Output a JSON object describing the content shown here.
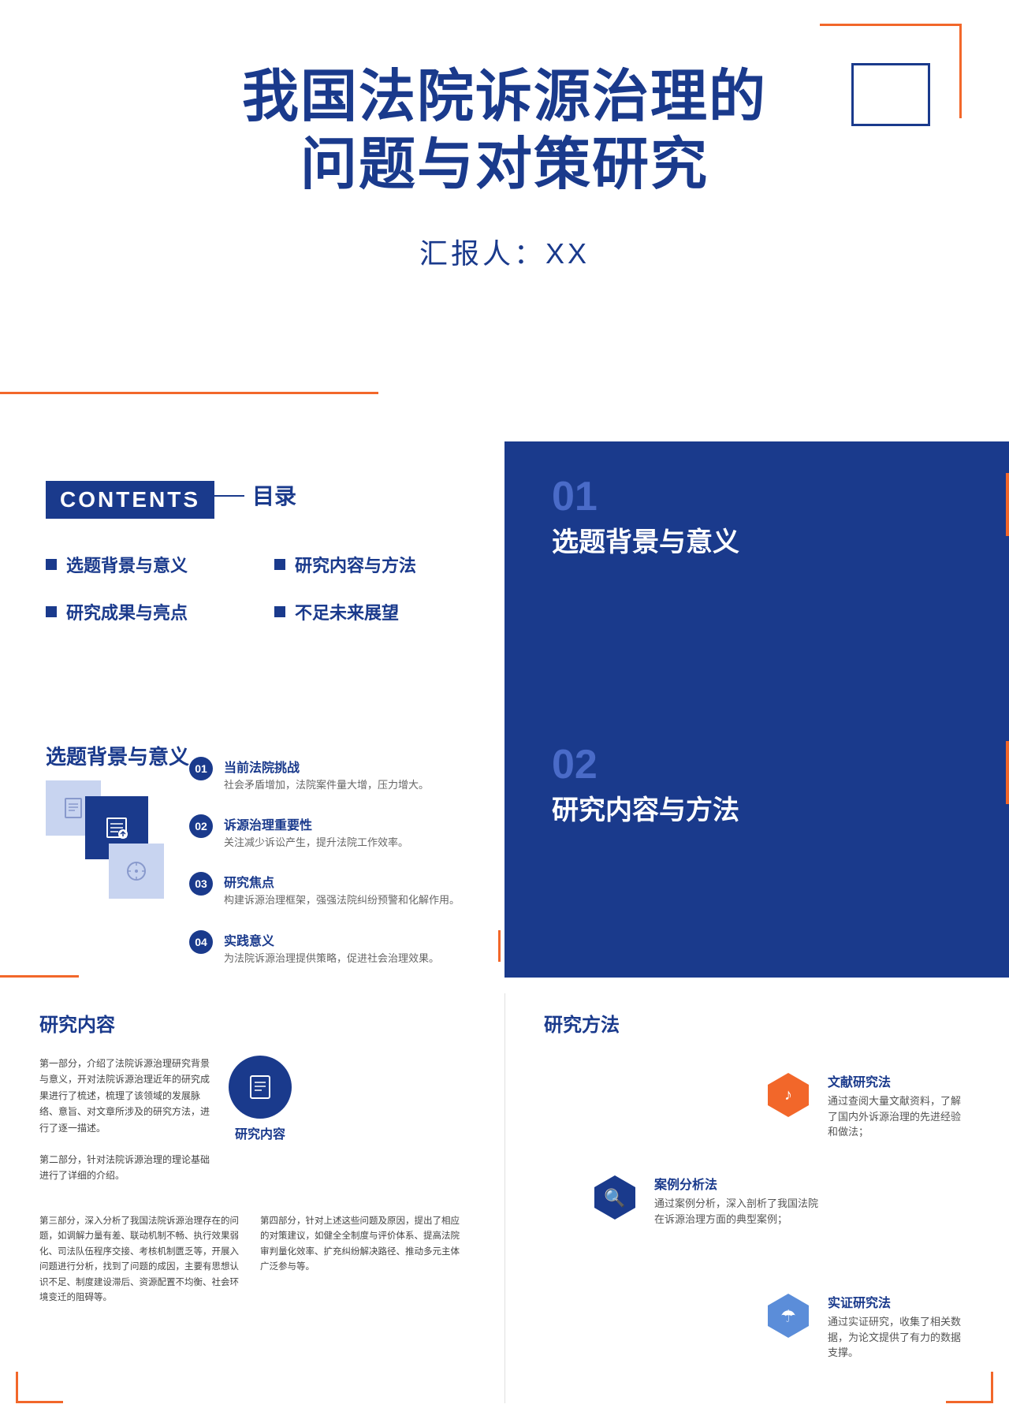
{
  "slide1": {
    "title_line1": "我国法院诉源治理的",
    "title_line2": "问题与对策研究",
    "reporter_label": "汇报人：XX"
  },
  "slide2": {
    "contents_label": "CONTENTS",
    "mulu_label": "目录",
    "toc_items": [
      {
        "id": 1,
        "label": "选题背景与意义"
      },
      {
        "id": 2,
        "label": "研究内容与方法"
      },
      {
        "id": 3,
        "label": "研究成果与亮点"
      },
      {
        "id": 4,
        "label": "不足未来展望"
      }
    ],
    "right_section": {
      "num": "01",
      "title": "选题背景与意义"
    }
  },
  "slide3": {
    "section_heading": "选题背景与意义",
    "items": [
      {
        "num": "01",
        "title": "当前法院挑战",
        "desc": "社会矛盾增加，法院案件量大增，压力增大。"
      },
      {
        "num": "02",
        "title": "诉源治理重要性",
        "desc": "关注减少诉讼产生，提升法院工作效率。"
      },
      {
        "num": "03",
        "title": "研究焦点",
        "desc": "构建诉源治理框架，强强法院纠纷预警和化解作用。"
      },
      {
        "num": "04",
        "title": "实践意义",
        "desc": "为法院诉源治理提供策略，促进社会治理效果。"
      }
    ],
    "right_section": {
      "num": "02",
      "title": "研究内容与方法"
    }
  },
  "slide4": {
    "left_heading": "研究内容",
    "right_heading": "研究方法",
    "center_icon_label": "研究内容",
    "text_blocks": [
      "第一部分，介绍了法院诉源治理研究背景与意义，开对法院诉源治理近年的研究成果进行了梳述，梳理了该领域的发展脉络、意旨、对文章所涉及的研究方法，进行了逐一描述。",
      "第二部分，针对法院诉源治理的理论基础进行了详细的介绍。",
      "第三部分，深入分析了我国法院诉源治理存在的问题，如调解力量有差、联动机制不畅、执行效果弱化、司法队伍程序交接、考核机制匮乏等，开展入问题进行分析，找到了问题的成因，主要有思想认识不足、制度建设滞后、资源配置不均衡、社会环境变迁的阻碍等。",
      "第四部分，针对上述这些问题及原因，提出了相应的对策建议，如健全全制度与评价体系、提高法院审判量化效率、扩充纠纷解决路径、推动多元主体广泛参与等。"
    ],
    "methods": [
      {
        "id": "wenxian",
        "color": "#f2672a",
        "icon": "♪",
        "title": "文献研究法",
        "desc": "通过查阅大量文献资料，了解了国内外诉源治理的先进经验和做法；"
      },
      {
        "id": "anli",
        "color": "#1a3a8c",
        "icon": "🔍",
        "title": "案例分析法",
        "desc": "通过案例分析，深入剖析了我国法院在诉源治理方面的典型案例；"
      },
      {
        "id": "shizheng",
        "color": "#5b8dd9",
        "icon": "☂",
        "title": "实证研究法",
        "desc": "通过实证研究，收集了相关数据，为论文提供了有力的数据支撑。"
      }
    ]
  }
}
